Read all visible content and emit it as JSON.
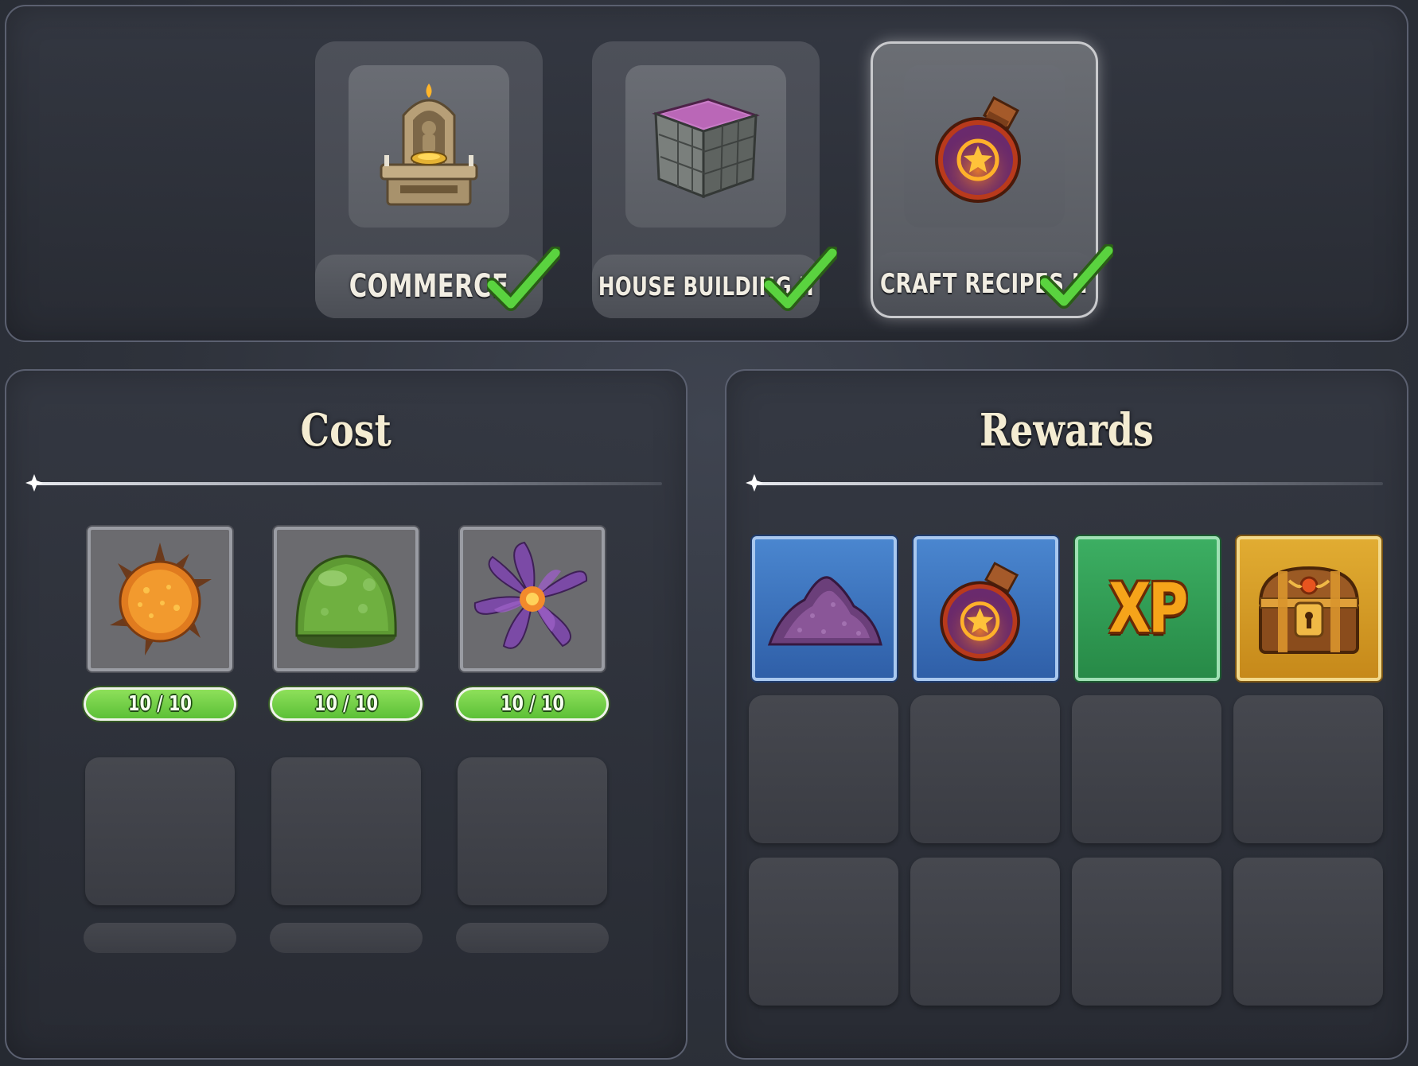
{
  "categories": [
    {
      "label": "COMMERCE",
      "icon": "shrine-icon",
      "completed": true,
      "selected": false
    },
    {
      "label": "HOUSE BUILDING II",
      "icon": "stone-block-icon",
      "completed": true,
      "selected": false
    },
    {
      "label": "CRAFT RECIPES II",
      "icon": "potion-flask-icon",
      "completed": true,
      "selected": true
    }
  ],
  "cost": {
    "title": "Cost",
    "items": [
      {
        "icon": "spiked-orange-seed-icon",
        "progress": "10 / 10"
      },
      {
        "icon": "green-slime-orb-icon",
        "progress": "10 / 10"
      },
      {
        "icon": "purple-flower-icon",
        "progress": "10 / 10"
      }
    ]
  },
  "rewards": {
    "title": "Rewards",
    "items": [
      {
        "icon": "purple-powder-pile-icon",
        "rarity": "blue"
      },
      {
        "icon": "potion-flask-icon",
        "rarity": "blue"
      },
      {
        "icon": "xp-icon",
        "text": "XP",
        "rarity": "green"
      },
      {
        "icon": "treasure-chest-icon",
        "rarity": "gold"
      }
    ]
  },
  "colors": {
    "progress_green": "#6fd346",
    "rarity_blue": "#3b70bd",
    "rarity_green": "#2f9a52",
    "rarity_gold": "#d49a22",
    "check_green": "#4fce3a"
  }
}
